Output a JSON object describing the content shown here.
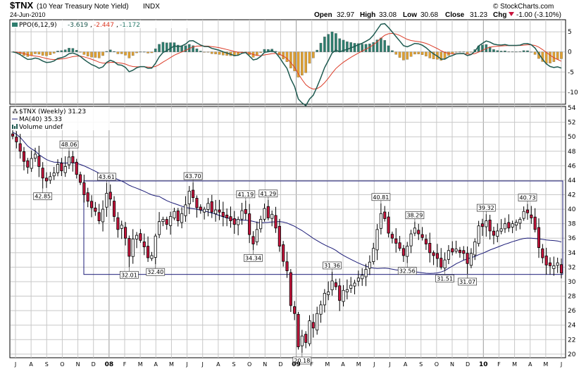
{
  "header": {
    "symbol": "$TNX",
    "name": "(10 Year Treasury Note Yield)",
    "exchange": "INDX",
    "brand": "© StockCharts.com",
    "date": "24-Jun-2010",
    "open_label": "Open",
    "open": "32.97",
    "high_label": "High",
    "high": "33.08",
    "low_label": "Low",
    "low": "30.68",
    "close_label": "Close",
    "close": "31.23",
    "chg_label": "Chg",
    "chg": "-1.00 (-3.10%)",
    "chg_icon": "down-triangle-icon"
  },
  "ppo_legend": {
    "name": "PPO(6,12,9)",
    "v1": "-3.619",
    "v2": "-2.447",
    "v3": "-1.172"
  },
  "price_legend": {
    "main": "$TNX (Weekly) 31.23",
    "ma": "MA(40) 35.33",
    "vol": "Volume undef"
  },
  "colors": {
    "up_candle": "#ffffff",
    "down_candle": "#c8143c",
    "candle_edge": "#000000",
    "ma_line": "#1c1c78",
    "ppo_line": "#1e5a50",
    "signal_line": "#dc3c28",
    "hist_pos": "#2e7d6e",
    "hist_neg": "#e0a030",
    "channel": "#1c1c78",
    "grid": "#c8c8c8"
  },
  "chart_data": [
    {
      "type": "candlestick",
      "title": "$TNX (Weekly) 31.23",
      "period": "Jul 2007 - Jun 2010, weekly",
      "y_axis_ticks": [
        20,
        22,
        24,
        26,
        28,
        30,
        32,
        34,
        36,
        38,
        40,
        42,
        44,
        46,
        48,
        50,
        52,
        54
      ],
      "ylim": [
        19.5,
        54.2
      ],
      "x_tick_labels": [
        "J",
        "A",
        "S",
        "O",
        "N",
        "D",
        "08",
        "F",
        "M",
        "A",
        "M",
        "J",
        "J",
        "A",
        "S",
        "O",
        "N",
        "D",
        "09",
        "F",
        "M",
        "A",
        "M",
        "J",
        "J",
        "A",
        "S",
        "O",
        "N",
        "D",
        "10",
        "F",
        "M",
        "A",
        "M",
        "J"
      ],
      "grid": true,
      "channel": {
        "top": 43.9,
        "bottom": 31.0
      },
      "close": [
        50.1,
        49.3,
        48.0,
        46.6,
        45.8,
        47.0,
        47.6,
        45.9,
        44.3,
        43.9,
        44.5,
        45.0,
        46.2,
        45.3,
        45.9,
        47.2,
        46.4,
        44.8,
        43.7,
        42.0,
        41.1,
        40.2,
        39.7,
        38.4,
        40.0,
        42.2,
        41.4,
        39.0,
        37.2,
        37.8,
        36.0,
        33.5,
        35.9,
        36.4,
        35.7,
        34.8,
        33.3,
        33.6,
        36.3,
        38.3,
        38.6,
        37.9,
        39.0,
        39.7,
        38.4,
        39.4,
        40.6,
        42.5,
        41.6,
        40.2,
        39.9,
        40.0,
        40.8,
        39.6,
        39.9,
        39.6,
        39.0,
        38.8,
        38.4,
        37.9,
        38.6,
        39.8,
        39.4,
        36.5,
        35.2,
        37.2,
        38.6,
        40.1,
        38.8,
        39.3,
        37.4,
        34.9,
        32.8,
        31.5,
        26.7,
        25.6,
        21.0,
        22.5,
        21.6,
        24.6,
        23.6,
        25.6,
        26.8,
        28.4,
        28.6,
        30.1,
        29.3,
        27.4,
        28.8,
        28.9,
        29.5,
        29.8,
        30.5,
        30.9,
        31.7,
        32.7,
        34.6,
        37.2,
        39.4,
        38.7,
        36.7,
        36.0,
        35.3,
        34.6,
        33.6,
        34.9,
        36.6,
        37.4,
        36.6,
        36.1,
        35.2,
        34.0,
        33.6,
        33.2,
        32.0,
        33.0,
        34.3,
        34.1,
        34.5,
        34.0,
        33.9,
        32.5,
        33.9,
        35.5,
        37.7,
        37.6,
        38.4,
        37.0,
        36.4,
        37.0,
        37.3,
        38.0,
        37.4,
        38.0,
        38.2,
        38.6,
        39.7,
        39.5,
        38.8,
        37.2,
        34.7,
        33.3,
        32.3,
        32.2,
        32.2,
        32.6,
        31.2
      ]
    },
    {
      "type": "line",
      "title": "PPO(6,12,9)",
      "series": [
        {
          "name": "PPO",
          "last": -3.619
        },
        {
          "name": "Signal",
          "last": -2.447
        },
        {
          "name": "Histogram",
          "last": -1.172
        }
      ],
      "y_axis_ticks": [
        -10,
        -5,
        0,
        5
      ],
      "ylim": [
        -13,
        8
      ]
    }
  ]
}
